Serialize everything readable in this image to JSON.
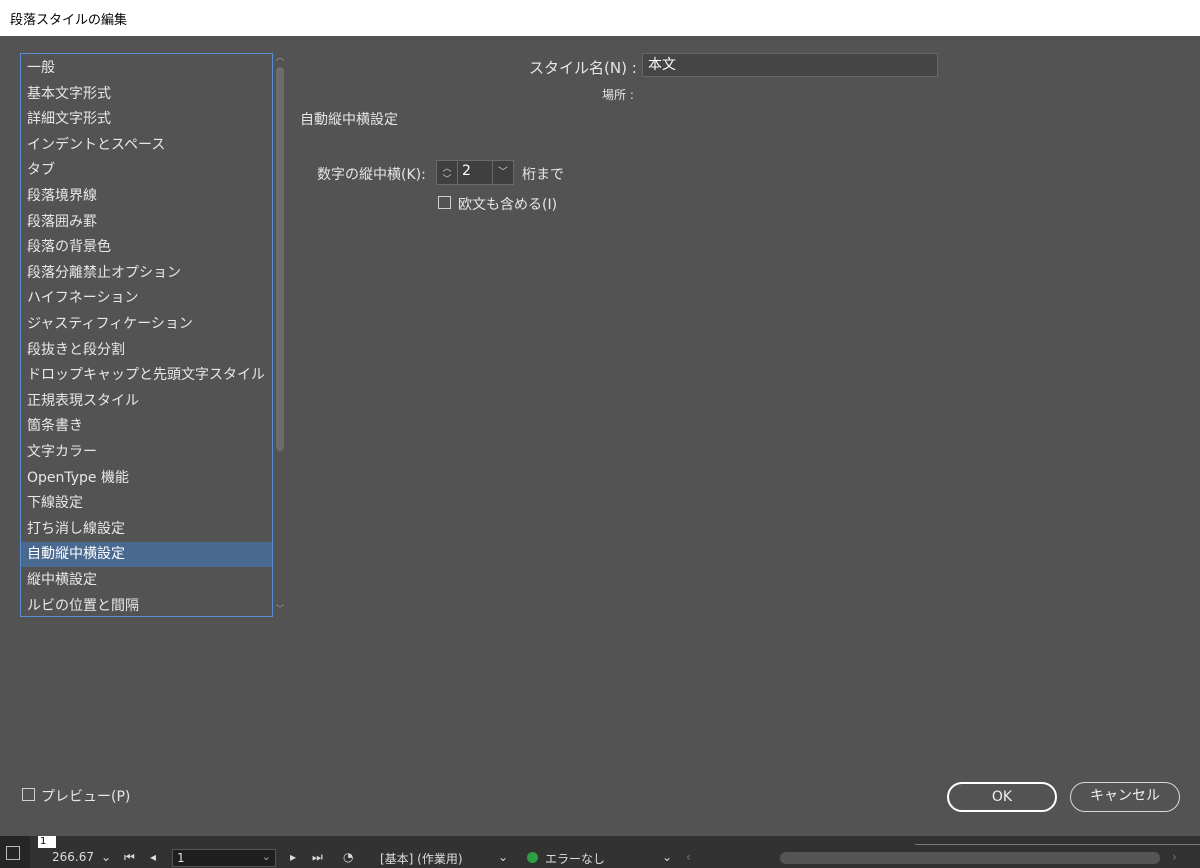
{
  "window": {
    "title": "段落スタイルの編集"
  },
  "sidebar": {
    "items": [
      {
        "label": "一般"
      },
      {
        "label": "基本文字形式"
      },
      {
        "label": "詳細文字形式"
      },
      {
        "label": "インデントとスペース"
      },
      {
        "label": "タブ"
      },
      {
        "label": "段落境界線"
      },
      {
        "label": "段落囲み罫"
      },
      {
        "label": "段落の背景色"
      },
      {
        "label": "段落分離禁止オプション"
      },
      {
        "label": "ハイフネーション"
      },
      {
        "label": "ジャスティフィケーション"
      },
      {
        "label": "段抜きと段分割"
      },
      {
        "label": "ドロップキャップと先頭文字スタイル"
      },
      {
        "label": "正規表現スタイル"
      },
      {
        "label": "箇条書き"
      },
      {
        "label": "文字カラー"
      },
      {
        "label": "OpenType 機能"
      },
      {
        "label": "下線設定"
      },
      {
        "label": "打ち消し線設定"
      },
      {
        "label": "自動縦中横設定",
        "selected": true
      },
      {
        "label": "縦中横設定"
      },
      {
        "label": "ルビの位置と間隔"
      }
    ]
  },
  "form": {
    "style_name_label": "スタイル名(N) :",
    "style_name_value": "本文",
    "location_label": "場所 :",
    "section_title": "自動縦中横設定",
    "digits_label": "数字の縦中横(K):",
    "digits_value": "2",
    "digits_suffix": "桁まで",
    "include_roman_label": "欧文も含める(I)",
    "include_roman_checked": false
  },
  "footer": {
    "preview_label": "プレビュー(P)",
    "preview_checked": false,
    "ok_label": "OK",
    "cancel_label": "キャンセル"
  },
  "statusbar": {
    "zoom": "266.67",
    "page_marker": "1",
    "page": "1",
    "profile": "[基本] (作業用)",
    "preflight": "エラーなし",
    "preflight_color": "#2ea043"
  }
}
